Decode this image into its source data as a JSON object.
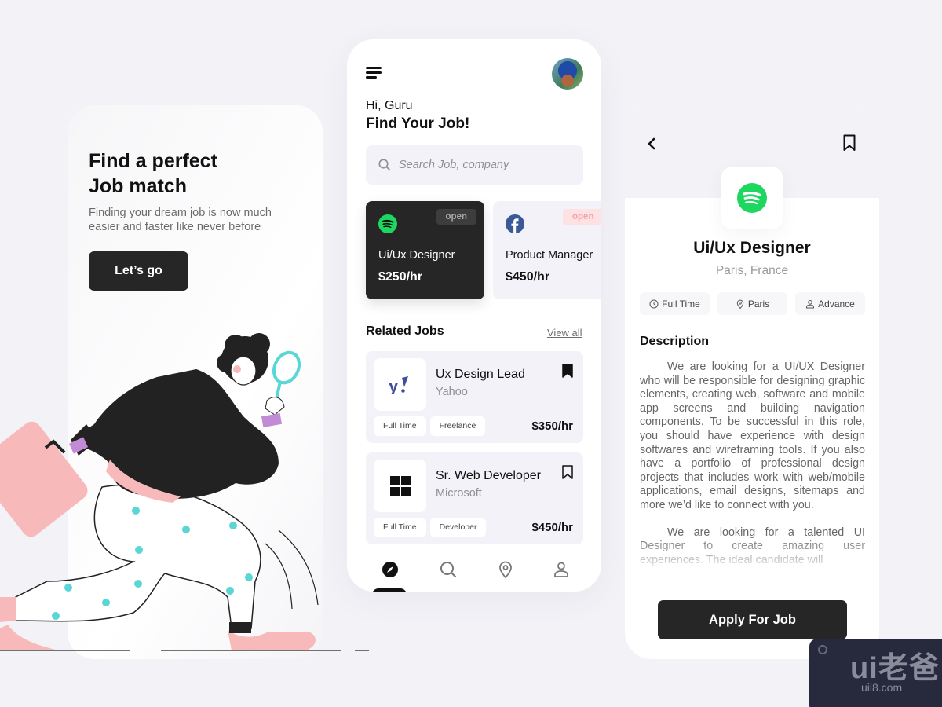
{
  "onboarding": {
    "title_line1": "Find a perfect",
    "title_line2": "Job match",
    "subtitle": "Finding your dream job is now much easier and faster like never before",
    "cta_label": "Let’s go"
  },
  "home": {
    "greeting": "Hi, Guru",
    "title": "Find Your Job!",
    "search": {
      "value": "",
      "placeholder": "Search Job, company"
    },
    "featured": [
      {
        "company_icon": "spotify-icon",
        "status": "open",
        "role": "Ui/Ux Designer",
        "rate": "$250/hr",
        "selected": true
      },
      {
        "company_icon": "facebook-icon",
        "status": "open",
        "role": "Product Manager",
        "rate": "$450/hr",
        "selected": false
      }
    ],
    "related_title": "Related Jobs",
    "view_all_label": "View all",
    "related": [
      {
        "title": "Ux Design Lead",
        "company": "Yahoo",
        "company_icon": "yahoo-icon",
        "tags": [
          "Full Time",
          "Freelance"
        ],
        "rate": "$350/hr",
        "bookmarked": true
      },
      {
        "title": "Sr. Web Developer",
        "company": "Microsoft",
        "company_icon": "microsoft-icon",
        "tags": [
          "Full Time",
          "Developer"
        ],
        "rate": "$450/hr",
        "bookmarked": false
      }
    ],
    "nav": [
      {
        "icon": "compass-icon",
        "active": true
      },
      {
        "icon": "search-icon",
        "active": false
      },
      {
        "icon": "location-pin-icon",
        "active": false
      },
      {
        "icon": "user-icon",
        "active": false
      }
    ]
  },
  "detail": {
    "company_icon": "spotify-icon",
    "title": "Ui/Ux Designer",
    "location": "Paris, France",
    "tags": [
      {
        "icon": "clock-icon",
        "label": "Full Time"
      },
      {
        "icon": "location-pin-icon",
        "label": "Paris"
      },
      {
        "icon": "user-icon",
        "label": "Advance"
      }
    ],
    "description_heading": "Description",
    "description_paragraphs": [
      "We are looking for a UI/UX Designer who will be responsible for designing graphic elements, creating web, software and mobile app screens and building navigation components. To be successful in this role, you should have experience with design softwares and wireframing tools. If you also have a portfolio of professional design projects that includes work with web/mobile applications, email designs, sitemaps and more we’d like to connect with you.",
      "We are looking for a talented UI Designer to create amazing user experiences. The ideal candidate will"
    ],
    "apply_label": "Apply For Job"
  },
  "watermark": {
    "brand": "ui老爸",
    "domain": "uil8.com"
  },
  "colors": {
    "dark": "#262626",
    "background": "#f2f2f7",
    "spotify": "#1ed760",
    "facebook": "#3b5998",
    "yahoo": "#3f4f9e",
    "accent_teal": "#5ad6d6",
    "accent_pink": "#f7b9b9"
  }
}
